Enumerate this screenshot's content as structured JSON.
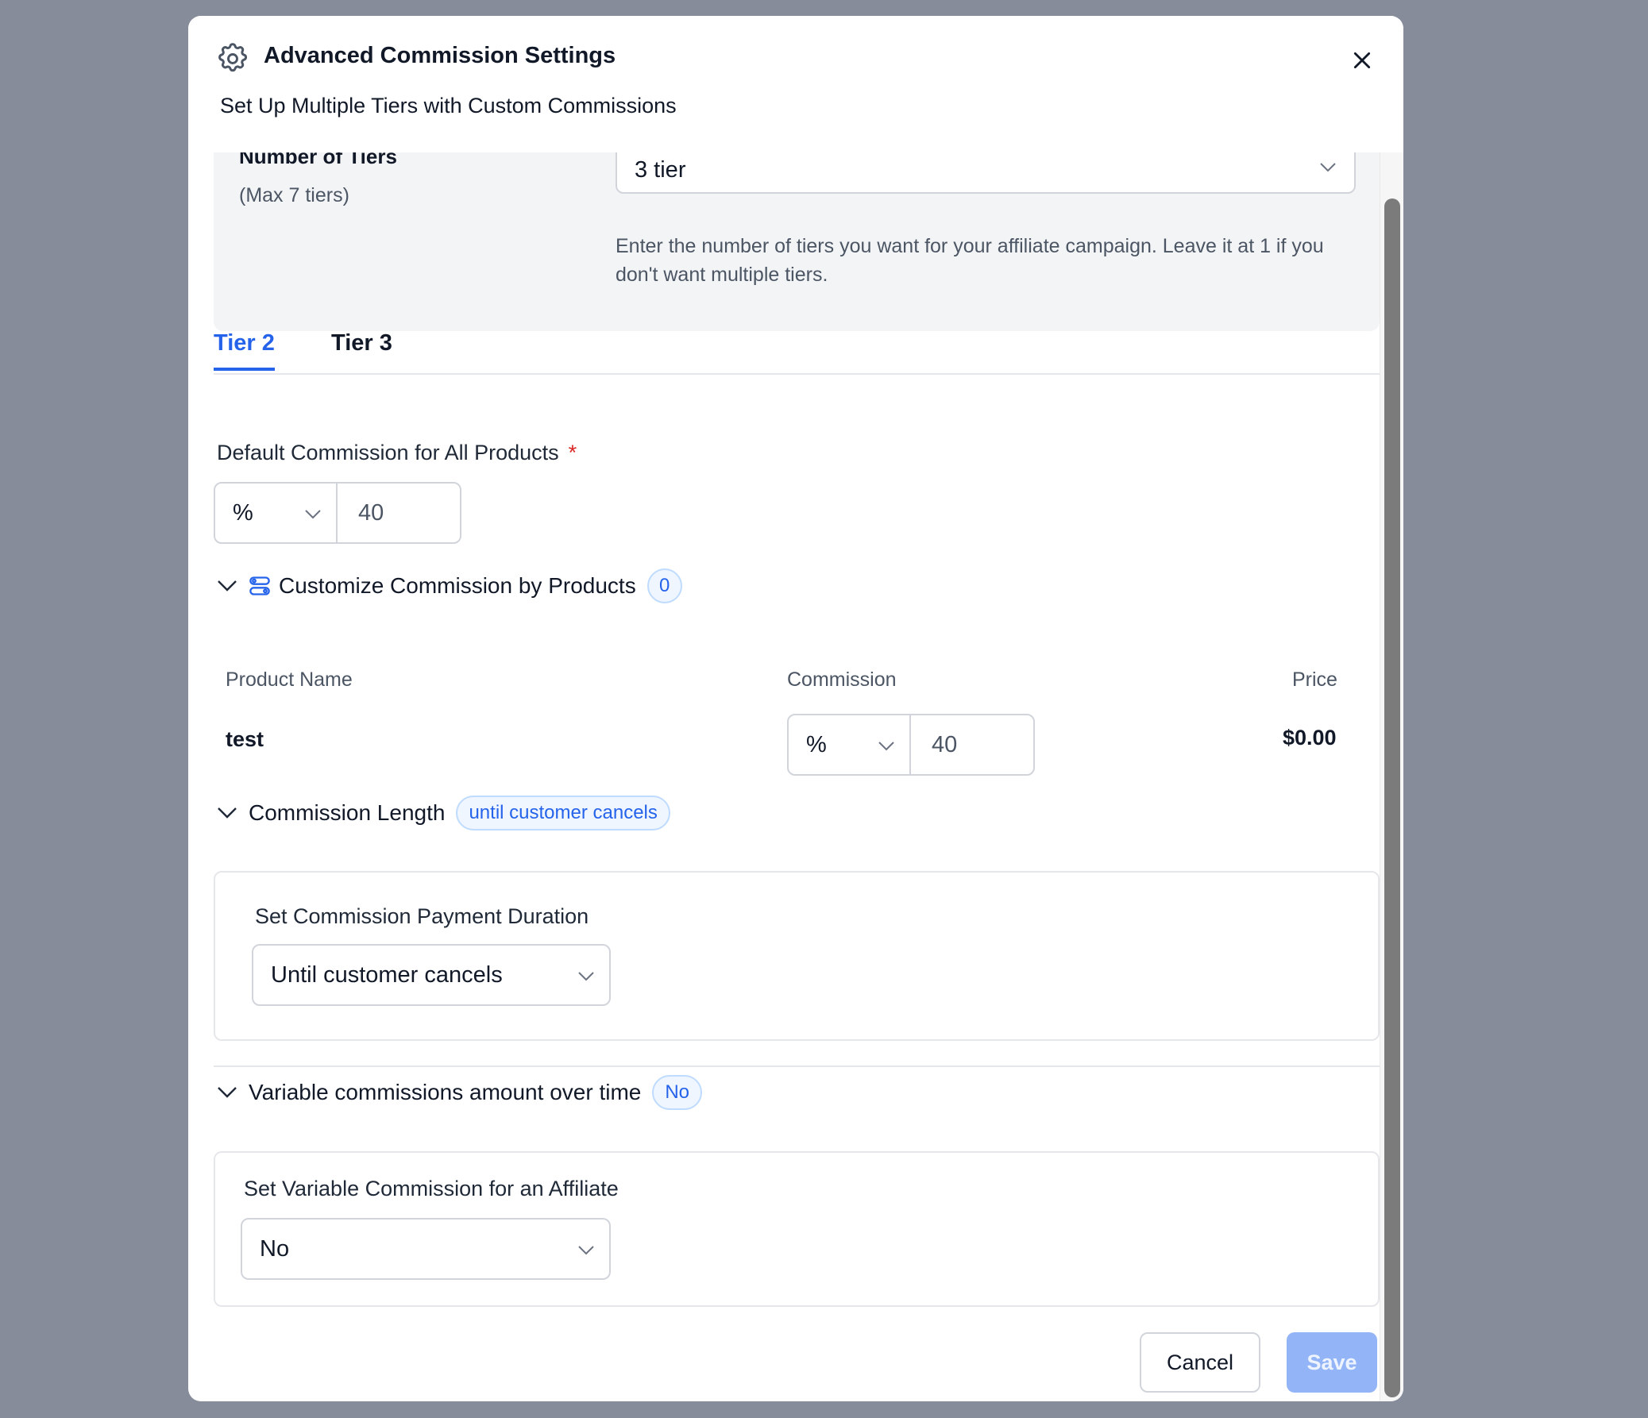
{
  "modal": {
    "title": "Advanced Commission Settings",
    "subtitle": "Set Up Multiple Tiers with Custom Commissions"
  },
  "tiers": {
    "label": "Number of Tiers",
    "sublabel": "(Max 7 tiers)",
    "selected": "3 tier",
    "help": "Enter the number of tiers you want for your affiliate campaign. Leave it at 1 if you don't want multiple tiers."
  },
  "tabs": [
    {
      "label": "Tier 2",
      "active": true
    },
    {
      "label": "Tier 3",
      "active": false
    }
  ],
  "default_commission": {
    "label": "Default Commission for All Products",
    "required_mark": "*",
    "type": "%",
    "value": "40"
  },
  "customize_products": {
    "title": "Customize Commission by Products",
    "count": "0",
    "columns": [
      "Product Name",
      "Commission",
      "Price"
    ],
    "rows": [
      {
        "name": "test",
        "type": "%",
        "value": "40",
        "price": "$0.00"
      }
    ]
  },
  "commission_length": {
    "title": "Commission Length",
    "badge": "until customer cancels",
    "field_label": "Set Commission Payment Duration",
    "selected": "Until customer cancels"
  },
  "variable_commission": {
    "title": "Variable commissions amount over time",
    "badge": "No",
    "field_label": "Set Variable Commission for an Affiliate",
    "selected": "No"
  },
  "footer": {
    "cancel_label": "Cancel",
    "save_label": "Save"
  },
  "colors": {
    "accent": "#2563eb",
    "save_disabled": "#93b5f7",
    "backdrop": "#868c9a"
  }
}
